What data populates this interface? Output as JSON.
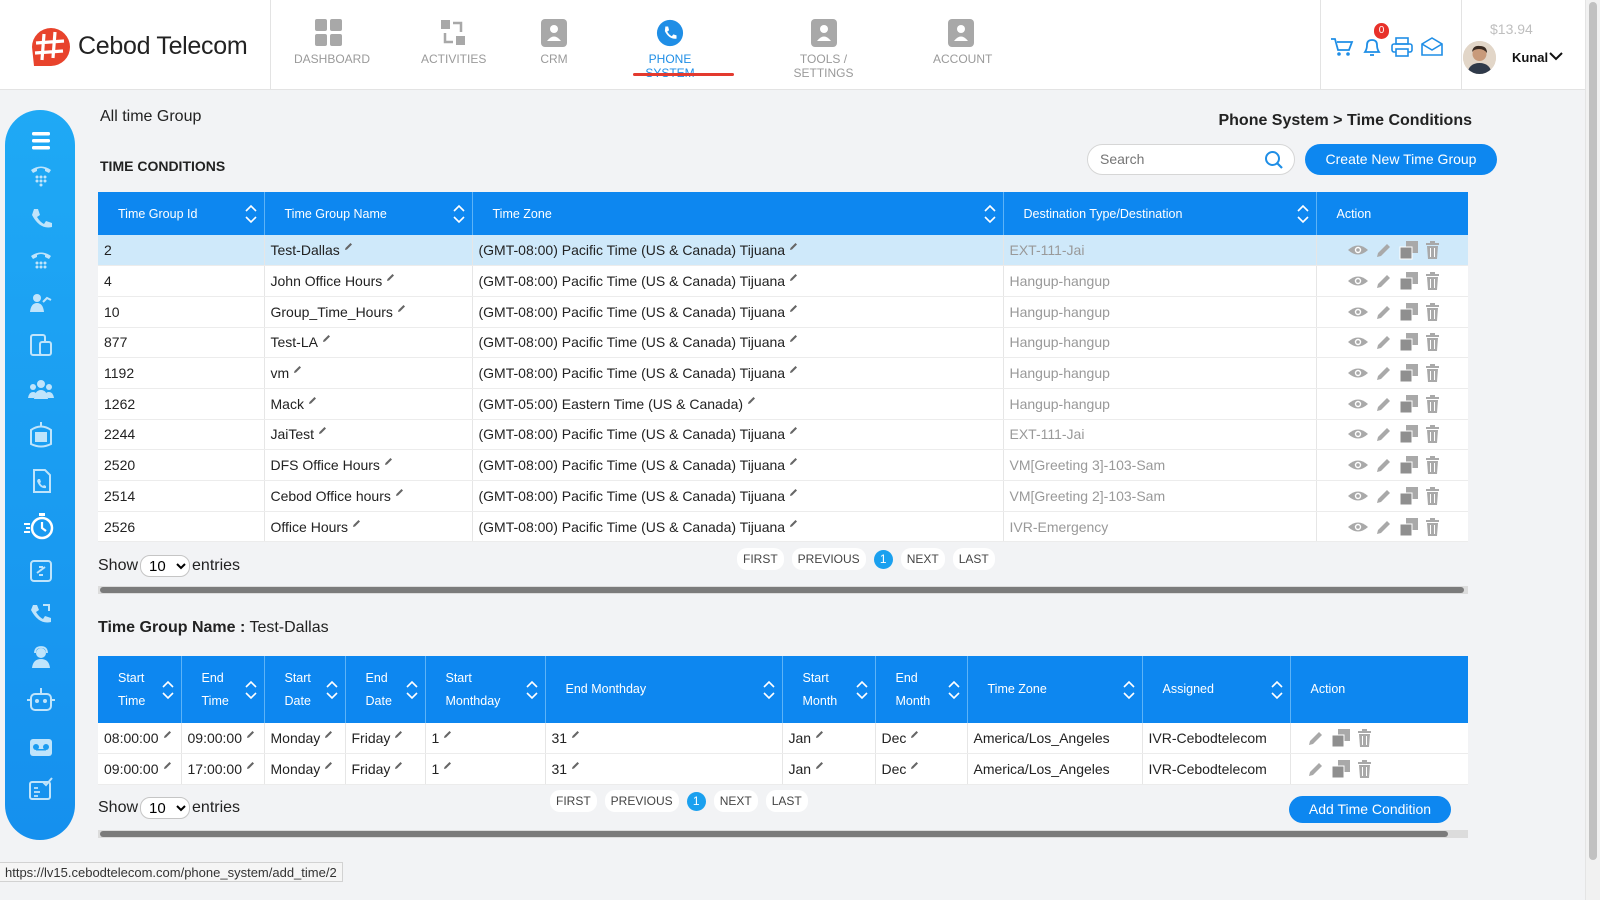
{
  "brand": {
    "name": "Cebod Telecom",
    "accent": "#0d87f0",
    "logo_color": "#e8432c"
  },
  "nav": [
    {
      "label": "DASHBOARD",
      "icon": "dashboard-icon"
    },
    {
      "label": "ACTIVITIES",
      "icon": "activities-icon"
    },
    {
      "label": "CRM",
      "icon": "crm-icon"
    },
    {
      "label": "PHONE SYSTEM",
      "icon": "phone-system-icon",
      "active": true
    },
    {
      "label": "TOOLS / SETTINGS",
      "icon": "tools-icon"
    },
    {
      "label": "ACCOUNT",
      "icon": "account-icon"
    }
  ],
  "header": {
    "notifications": "0",
    "balance": "$13.94",
    "user": "Kunal"
  },
  "sidebar_icons": [
    "menu-icon",
    "ip-phone-icon",
    "phone-icon",
    "fax-icon",
    "users-call-icon",
    "devices-icon",
    "team-icon",
    "ivr-icon",
    "phone-book-icon",
    "timer-icon",
    "link-icon",
    "call-forward-icon",
    "agent-icon",
    "robot-icon",
    "voicemail-icon",
    "user-check-icon"
  ],
  "page": {
    "title": "All time Group",
    "breadcrumb": "Phone System > Time Conditions",
    "section": "TIME CONDITIONS",
    "search_placeholder": "Search",
    "create_button": "Create New Time Group"
  },
  "time_groups": {
    "columns": [
      "Time Group Id",
      "Time Group Name",
      "Time Zone",
      "Destination Type/Destination",
      "Action"
    ],
    "rows": [
      {
        "id": "2",
        "name": "Test-Dallas",
        "tz": "(GMT-08:00) Pacific Time (US & Canada) Tijuana",
        "dest": "EXT-111-Jai"
      },
      {
        "id": "4",
        "name": "John Office Hours",
        "tz": "(GMT-08:00) Pacific Time (US & Canada) Tijuana",
        "dest": "Hangup-hangup"
      },
      {
        "id": "10",
        "name": "Group_Time_Hours",
        "tz": "(GMT-08:00) Pacific Time (US & Canada) Tijuana",
        "dest": "Hangup-hangup"
      },
      {
        "id": "877",
        "name": "Test-LA",
        "tz": "(GMT-08:00) Pacific Time (US & Canada) Tijuana",
        "dest": "Hangup-hangup"
      },
      {
        "id": "1192",
        "name": "vm",
        "tz": "(GMT-08:00) Pacific Time (US & Canada) Tijuana",
        "dest": "Hangup-hangup"
      },
      {
        "id": "1262",
        "name": "Mack",
        "tz": "(GMT-05:00) Eastern Time (US & Canada)",
        "dest": "Hangup-hangup"
      },
      {
        "id": "2244",
        "name": "JaiTest",
        "tz": "(GMT-08:00) Pacific Time (US & Canada) Tijuana",
        "dest": "EXT-111-Jai"
      },
      {
        "id": "2520",
        "name": "DFS Office Hours",
        "tz": "(GMT-08:00) Pacific Time (US & Canada) Tijuana",
        "dest": "VM[Greeting 3]-103-Sam"
      },
      {
        "id": "2514",
        "name": "Cebod Office hours",
        "tz": "(GMT-08:00) Pacific Time (US & Canada) Tijuana",
        "dest": "VM[Greeting 2]-103-Sam"
      },
      {
        "id": "2526",
        "name": "Office Hours",
        "tz": "(GMT-08:00) Pacific Time (US & Canada) Tijuana",
        "dest": "IVR-Emergency"
      }
    ],
    "show_label": "Show",
    "entries_label": "entries",
    "page_size": "10",
    "pager": {
      "first": "FIRST",
      "previous": "PREVIOUS",
      "current": "1",
      "next": "NEXT",
      "last": "LAST"
    }
  },
  "group_detail": {
    "label": "Time Group Name :",
    "name": "Test-Dallas",
    "columns": [
      [
        "Start",
        "Time"
      ],
      [
        "End",
        "Time"
      ],
      [
        "Start",
        "Date"
      ],
      [
        "End",
        "Date"
      ],
      [
        "Start",
        "Monthday"
      ],
      [
        "End Monthday"
      ],
      [
        "Start",
        "Month"
      ],
      [
        "End",
        "Month"
      ],
      [
        "Time Zone"
      ],
      [
        "Assigned"
      ],
      [
        "Action"
      ]
    ],
    "rows": [
      {
        "start_time": "08:00:00",
        "end_time": "09:00:00",
        "start_date": "Monday",
        "end_date": "Friday",
        "start_monthday": "1",
        "end_monthday": "31",
        "start_month": "Jan",
        "end_month": "Dec",
        "tz": "America/Los_Angeles",
        "assigned": "IVR-Cebodtelecom"
      },
      {
        "start_time": "09:00:00",
        "end_time": "17:00:00",
        "start_date": "Monday",
        "end_date": "Friday",
        "start_monthday": "1",
        "end_monthday": "31",
        "start_month": "Jan",
        "end_month": "Dec",
        "tz": "America/Los_Angeles",
        "assigned": "IVR-Cebodtelecom"
      }
    ],
    "show_label": "Show",
    "entries_label": "entries",
    "page_size": "10",
    "pager": {
      "first": "FIRST",
      "previous": "PREVIOUS",
      "current": "1",
      "next": "NEXT",
      "last": "LAST"
    },
    "add_button": "Add Time Condition"
  },
  "status_bar": {
    "url": "https://lv15.cebodtelecom.com/phone_system/add_time/2"
  }
}
